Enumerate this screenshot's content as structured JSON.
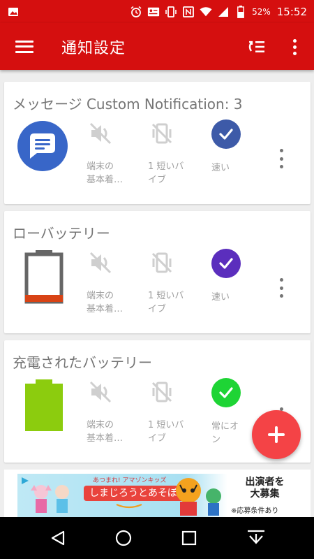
{
  "status_bar": {
    "battery_percent": "52%",
    "time": "15:52",
    "icons": [
      "image-icon",
      "alarm-icon",
      "contact-card-icon",
      "vibrate-icon",
      "nfc-icon",
      "wifi-icon",
      "signal-icon",
      "battery-icon"
    ]
  },
  "app_bar": {
    "title": "通知設定",
    "icons": [
      "menu-icon",
      "sort-icon",
      "more-vert-icon"
    ]
  },
  "cards": [
    {
      "title": "メッセージ Custom Notification: 3",
      "icon": "messages-app-icon",
      "sound_label": "端末の\n基本着…",
      "vibration_label": "1 短いバ\nイブ",
      "speed_label": "速い",
      "speed_color": "#3d5aa8"
    },
    {
      "title": "ローバッテリー",
      "icon": "battery-low-icon",
      "sound_label": "端末の\n基本着…",
      "vibration_label": "1 短いバ\nイブ",
      "speed_label": "速い",
      "speed_color": "#5b2ebd"
    },
    {
      "title": "充電されたバッテリー",
      "icon": "battery-full-icon",
      "sound_label": "端末の\n基本着…",
      "vibration_label": "1 短いバ\nイブ",
      "speed_label": "常にオ\nン",
      "speed_color": "#1ed435"
    }
  ],
  "ad": {
    "small_text": "あつまれ! アマゾンキッズ",
    "main_text": "しまじろうとあそぼう!",
    "recruit_text": "出演者を\n大募集",
    "note_text": "※応募条件あり"
  },
  "colors": {
    "primary": "#d50f0f",
    "fab": "#f44346"
  }
}
